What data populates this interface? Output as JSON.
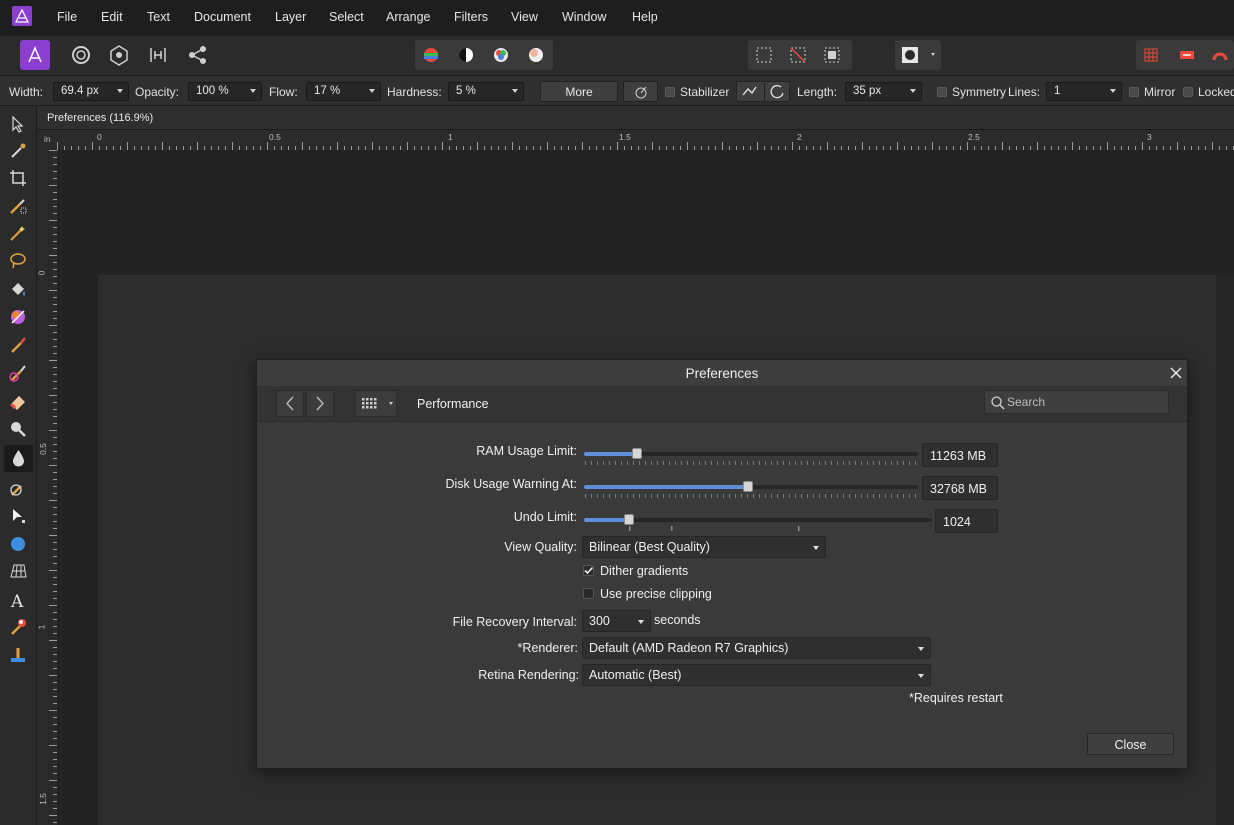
{
  "menu": [
    "File",
    "Edit",
    "Text",
    "Document",
    "Layer",
    "Select",
    "Arrange",
    "Filters",
    "View",
    "Window",
    "Help"
  ],
  "context_toolbar": {
    "width_label": "Width:",
    "width_value": "69.4 px",
    "opacity_label": "Opacity:",
    "opacity_value": "100 %",
    "flow_label": "Flow:",
    "flow_value": "17 %",
    "hardness_label": "Hardness:",
    "hardness_value": "5 %",
    "more_label": "More",
    "stabilizer_label": "Stabilizer",
    "length_label": "Length:",
    "length_value": "35 px",
    "symmetry_label": "Symmetry",
    "lines_label": "Lines:",
    "lines_value": "1",
    "mirror_label": "Mirror",
    "locked_label": "Locked"
  },
  "document": {
    "tab_title": "Preferences (116.9%)",
    "ruler_unit": "in",
    "hruler_labels": [
      "0",
      "0.5",
      "1",
      "1.5",
      "2",
      "2.5",
      "3"
    ],
    "vruler_labels": [
      "0",
      "0.5",
      "1",
      "1.5"
    ]
  },
  "dialog": {
    "title": "Preferences",
    "section": "Performance",
    "search_placeholder": "Search",
    "ram_label": "RAM Usage Limit:",
    "ram_value": "11263 MB",
    "ram_fraction": 0.16,
    "disk_label": "Disk Usage Warning At:",
    "disk_value": "32768 MB",
    "disk_fraction": 0.49,
    "undo_label": "Undo Limit:",
    "undo_value": "1024",
    "undo_fraction": 0.13,
    "view_quality_label": "View Quality:",
    "view_quality_value": "Bilinear (Best Quality)",
    "dither_label": "Dither gradients",
    "dither_checked": true,
    "precise_label": "Use precise clipping",
    "precise_checked": false,
    "recovery_label": "File Recovery Interval:",
    "recovery_value": "300",
    "recovery_unit": "seconds",
    "renderer_label": "*Renderer:",
    "renderer_value": "Default (AMD Radeon R7 Graphics)",
    "retina_label": "Retina Rendering:",
    "retina_value": "Automatic (Best)",
    "restart_note": "*Requires restart",
    "close_label": "Close"
  },
  "colors": {
    "accent": "#5f8fd8",
    "affinity_purple": "#8a3fd1"
  }
}
